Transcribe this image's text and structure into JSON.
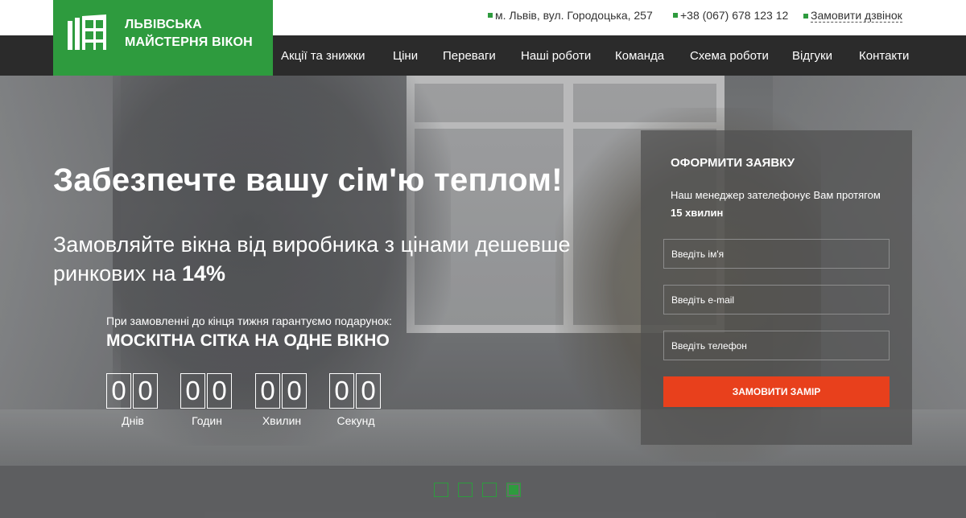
{
  "header": {
    "logo_line1": "ЛЬВІВСЬКА",
    "logo_line2": "МАЙСТЕРНЯ ВІКОН",
    "address": "м. Львів, вул. Городоцька, 257",
    "phone": "+38 (067) 678 123 12",
    "callback": "Замовити дзвінок"
  },
  "nav": {
    "items": [
      {
        "label": "Акції та знижки"
      },
      {
        "label": "Ціни"
      },
      {
        "label": "Переваги"
      },
      {
        "label": "Наші роботи"
      },
      {
        "label": "Команда"
      },
      {
        "label": "Схема роботи"
      },
      {
        "label": "Відгуки"
      },
      {
        "label": "Контакти"
      }
    ]
  },
  "hero": {
    "title": "Забезпечте вашу сім'ю теплом!",
    "subtitle_text": "Замовляйте вікна від виробника з цінами дешевше ринкових на",
    "subtitle_highlight": "14%",
    "gift_note": "При замовленні до кінця тижня гарантуємо подарунок:",
    "gift_title": "МОСКІТНА СІТКА НА ОДНЕ ВІКНО",
    "countdown": [
      {
        "digits": [
          "0",
          "0"
        ],
        "label": "Днів"
      },
      {
        "digits": [
          "0",
          "0"
        ],
        "label": "Годин"
      },
      {
        "digits": [
          "0",
          "0"
        ],
        "label": "Хвилин"
      },
      {
        "digits": [
          "0",
          "0"
        ],
        "label": "Секунд"
      }
    ],
    "slider": {
      "count": 4,
      "active": 4
    }
  },
  "form": {
    "title": "ОФОРМИТИ ЗАЯВКУ",
    "desc_text": "Наш менеджер зателефонує Вам протягом",
    "desc_highlight": "15 хвилин",
    "name_placeholder": "Введіть ім'я",
    "email_placeholder": "Введіть e-mail",
    "phone_placeholder": "Введіть телефон",
    "submit_label": "ЗАМОВИТИ ЗАМІР"
  },
  "colors": {
    "brand_green": "#2e9b3e",
    "nav_bg": "#2b2b2b",
    "cta_orange": "#e8401c"
  }
}
